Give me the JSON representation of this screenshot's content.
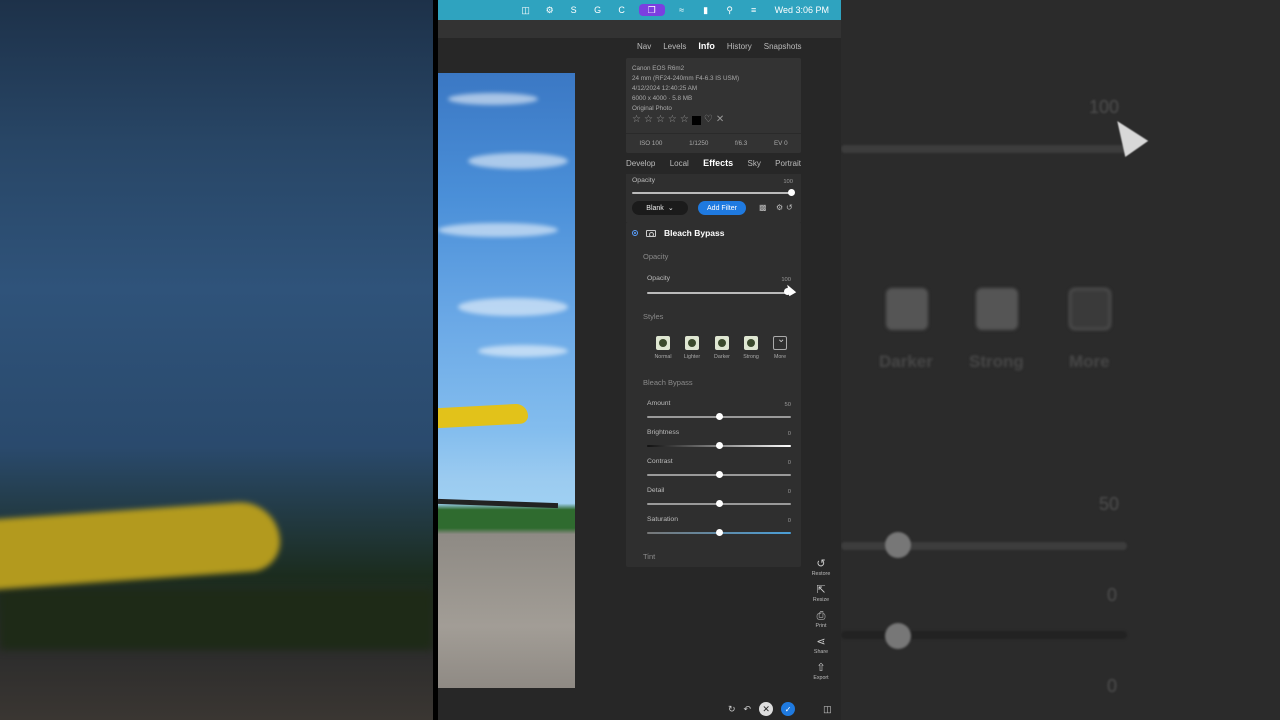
{
  "menubar": {
    "clock": "Wed 3:06 PM",
    "icons": [
      "screen-icon",
      "app-icon",
      "s-icon",
      "g-icon",
      "c-icon",
      "window-icon",
      "wifi-icon",
      "battery-icon",
      "search-icon",
      "control-center-icon"
    ]
  },
  "top_tabs": [
    "Nav",
    "Levels",
    "Info",
    "History",
    "Snapshots"
  ],
  "info": {
    "camera": "Canon EOS R6m2",
    "lens": "24 mm (RF24-240mm F4-6.3 IS USM)",
    "date": "4/12/2024 12:40:25 AM",
    "size": "6000 x 4000 · 5.8 MB",
    "label": "Original Photo",
    "exif": [
      "ISO 100",
      "1/1250",
      "f/6.3",
      "EV 0"
    ]
  },
  "module_tabs": [
    "Develop",
    "Local",
    "Effects",
    "Sky",
    "Portrait"
  ],
  "effects_top": {
    "opacity_label": "Opacity",
    "opacity_value": "100",
    "opacity_level": 1.0,
    "blank_label": "Blank",
    "add_filter_label": "Add Filter"
  },
  "filter": {
    "title": "Bleach Bypass",
    "opacity_section": "Opacity",
    "opacity_label": "Opacity",
    "opacity_value": "100",
    "opacity_level": 1.0,
    "styles_section": "Styles",
    "styles": [
      "Normal",
      "Lighter",
      "Darker",
      "Strong",
      "More"
    ],
    "bypass_section": "Bleach Bypass",
    "sliders": [
      {
        "label": "Amount",
        "value": "50",
        "level": 0.5
      },
      {
        "label": "Brightness",
        "value": "0",
        "level": 0.5
      },
      {
        "label": "Contrast",
        "value": "0",
        "level": 0.5
      },
      {
        "label": "Detail",
        "value": "0",
        "level": 0.5
      },
      {
        "label": "Saturation",
        "value": "0",
        "level": 0.5
      }
    ],
    "tint_section": "Tint"
  },
  "side_tools": [
    "Restore",
    "Resize",
    "Print",
    "Share",
    "Export"
  ],
  "background_right": {
    "value_top": "100",
    "labels": [
      "Darker",
      "Strong",
      "More"
    ],
    "values": [
      "50",
      "0",
      "0"
    ]
  },
  "colors": {
    "menubar": "#2fa3bf",
    "accent": "#1f7ae0",
    "panel": "#2f2f2f",
    "app_bg": "#272727"
  }
}
